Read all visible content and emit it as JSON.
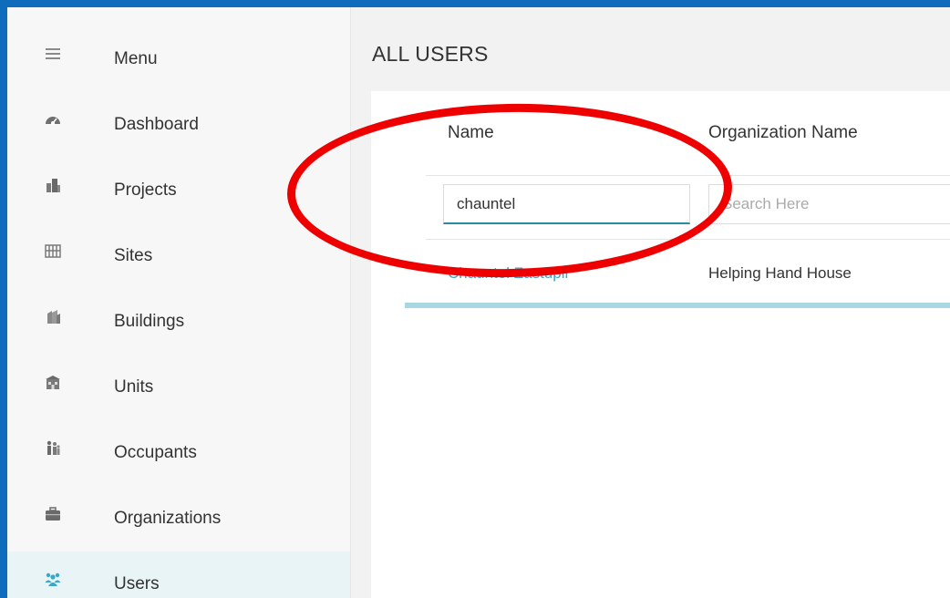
{
  "sidebar": {
    "items": [
      {
        "label": "Menu",
        "icon": "hamburger-menu-icon"
      },
      {
        "label": "Dashboard",
        "icon": "dashboard-gauge-icon"
      },
      {
        "label": "Projects",
        "icon": "projects-buildings-icon"
      },
      {
        "label": "Sites",
        "icon": "sites-grid-icon"
      },
      {
        "label": "Buildings",
        "icon": "buildings-icon"
      },
      {
        "label": "Units",
        "icon": "units-icon"
      },
      {
        "label": "Occupants",
        "icon": "occupants-people-icon"
      },
      {
        "label": "Organizations",
        "icon": "briefcase-icon"
      },
      {
        "label": "Users",
        "icon": "users-group-icon",
        "active": true
      }
    ]
  },
  "main": {
    "title": "ALL USERS",
    "columns": [
      "Name",
      "Organization Name"
    ],
    "filters": {
      "name_value": "chauntel",
      "org_placeholder": "Search Here"
    },
    "rows": [
      {
        "name": "Chauntel Zastupil",
        "organization": "Helping Hand House"
      }
    ]
  },
  "colors": {
    "frame_border": "#0f6cbd",
    "link": "#3ea3c6",
    "annotation_circle": "#ee0000",
    "active_nav_bg": "#e9f4f7",
    "users_icon": "#3aa7c8"
  }
}
